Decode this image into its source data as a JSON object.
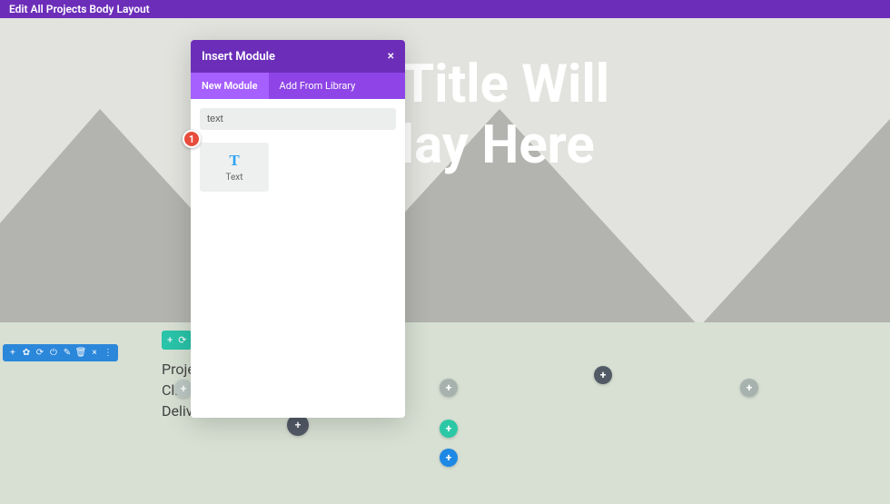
{
  "top_bar": {
    "title": "Edit All Projects Body Layout"
  },
  "hero": {
    "title": "Your Title Will\nDisplay Here"
  },
  "modal": {
    "title": "Insert Module",
    "close_glyph": "×",
    "tabs": {
      "new": "New Module",
      "library": "Add From Library"
    },
    "search_value": "text",
    "module_text": {
      "icon": "T",
      "label": "Text"
    }
  },
  "annotation": {
    "num": "1"
  },
  "project_text": {
    "l1": "Proje",
    "l2": "Clien",
    "l3": "Deliv"
  },
  "toolbar_icons": [
    "+",
    "✿",
    "⟳",
    "⏻",
    "✎",
    "🗑",
    "×",
    "⋮"
  ],
  "green_icons": [
    "+",
    "⟳"
  ],
  "plus": "+"
}
